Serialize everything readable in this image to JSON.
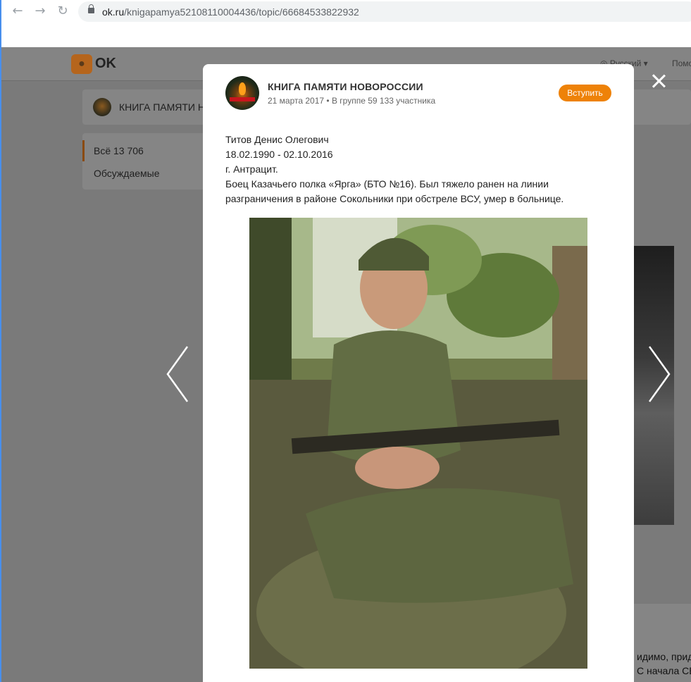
{
  "browser": {
    "url_domain": "ok.ru",
    "url_path": "/knigapamya52108110004436/topic/66684533822932"
  },
  "site": {
    "logo_text": "OK",
    "language": "Русский",
    "help": "Помо",
    "group_name": "КНИГА ПАМЯТИ Н",
    "menu": [
      {
        "label": "Всё 13 706"
      },
      {
        "label": "Обсуждаемые"
      }
    ],
    "bg_text_1": "идимо, прид",
    "bg_text_2": "С начала СВ"
  },
  "post": {
    "group_title": "КНИГА ПАМЯТИ НОВОРОССИИ",
    "meta": "21 марта 2017 • В группе 59 133 участника",
    "join_label": "Вступить",
    "lines": [
      "Титов Денис Олегович",
      "18.02.1990 - 02.10.2016",
      "г. Антрацит.",
      "Боец Казачьего полка «Ярга» (БТО №16). Был тяжело ранен на линии",
      "разграничения в районе Сокольники при обстреле ВСУ, умер в больнице."
    ]
  },
  "colors": {
    "accent": "#ee8208",
    "overlay": "#7a7a7a"
  }
}
